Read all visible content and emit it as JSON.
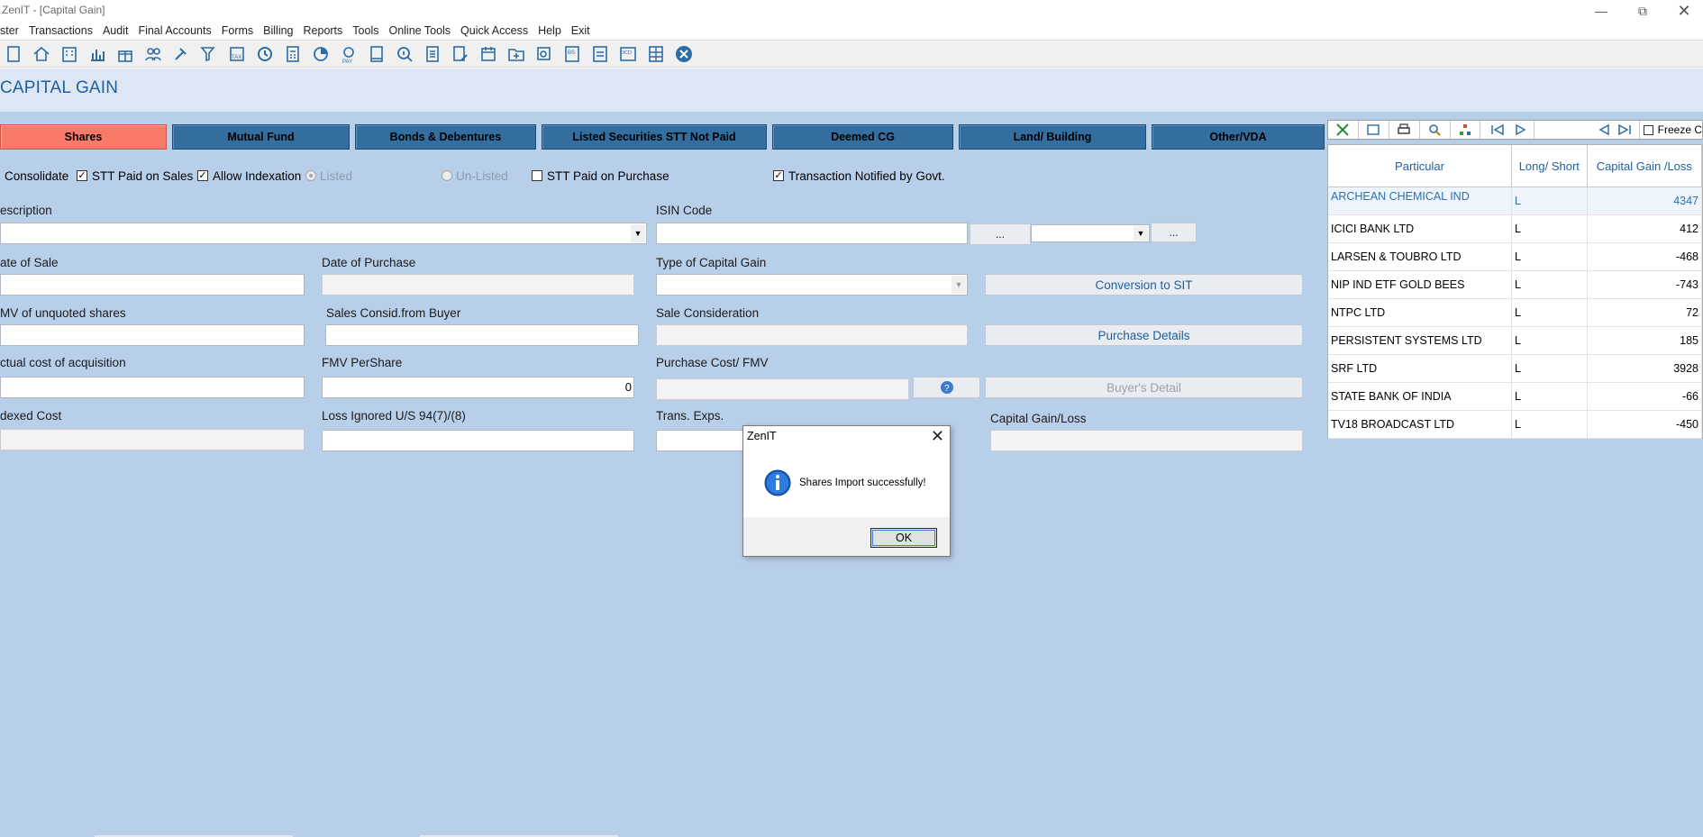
{
  "window": {
    "title": "ZenIT - [Capital Gain]",
    "controls": [
      "minimize",
      "restore",
      "close"
    ]
  },
  "menu": [
    "ster",
    "Transactions",
    "Audit",
    "Final Accounts",
    "Forms",
    "Billing",
    "Reports",
    "Tools",
    "Online Tools",
    "Quick Access",
    "Help",
    "Exit"
  ],
  "page": {
    "title": "CAPITAL GAIN"
  },
  "tabs": [
    "Shares",
    "Mutual Fund",
    "Bonds & Debentures",
    "Listed Securities STT Not Paid",
    "Deemed CG",
    "Land/ Building",
    "Other/VDA"
  ],
  "options": {
    "consolidate": "Consolidate",
    "stt_sales": "STT Paid on Sales",
    "indexation": "Allow Indexation",
    "listed": "Listed",
    "unlisted": "Un-Listed",
    "stt_purchase": "STT Paid on Purchase",
    "notified": "Transaction Notified by Govt."
  },
  "labels": {
    "description": "escription",
    "isin": "ISIN Code",
    "date_sale": "ate of Sale",
    "date_purchase": "Date of Purchase",
    "type_cg": "Type of Capital Gain",
    "fmv_unquoted": "MV of unquoted shares",
    "sales_consid_buyer": "Sales Consid.from Buyer",
    "sale_consideration": "Sale Consideration",
    "actual_cost": "ctual cost of acquisition",
    "fmv_per_share": "FMV PerShare",
    "purchase_cost_fmv": "Purchase Cost/ FMV",
    "indexed_cost": "dexed Cost",
    "loss_ignored": "Loss Ignored U/S 94(7)/(8)",
    "trans_exps": "Trans. Exps.",
    "capital_gain_loss": "Capital Gain/Loss"
  },
  "values": {
    "fmv_per_share": "0"
  },
  "buttons": {
    "isin_browse": "...",
    "dd_browse": "...",
    "conversion": "Conversion to SIT",
    "purchase_details": "Purchase Details",
    "buyers_detail": "Buyer's Detail"
  },
  "grid": {
    "freeze": "Freeze C",
    "headers": [
      "Particular",
      "Long/ Short",
      "Capital Gain /Loss"
    ],
    "rows": [
      {
        "particular": "ARCHEAN CHEMICAL IND",
        "ls": "L",
        "cg": "4347"
      },
      {
        "particular": "ICICI BANK LTD",
        "ls": "L",
        "cg": "412"
      },
      {
        "particular": "LARSEN & TOUBRO LTD",
        "ls": "L",
        "cg": "-468"
      },
      {
        "particular": "NIP IND ETF GOLD BEES",
        "ls": "L",
        "cg": "-743"
      },
      {
        "particular": "NTPC LTD",
        "ls": "L",
        "cg": "72"
      },
      {
        "particular": "PERSISTENT SYSTEMS LTD",
        "ls": "L",
        "cg": "185"
      },
      {
        "particular": "SRF LTD",
        "ls": "L",
        "cg": "3928"
      },
      {
        "particular": "STATE BANK OF INDIA",
        "ls": "L",
        "cg": "-66"
      },
      {
        "particular": "TV18 BROADCAST LTD",
        "ls": "L",
        "cg": "-450"
      }
    ]
  },
  "dialog": {
    "title": "ZenIT",
    "message": "Shares Import successfully!",
    "ok": "OK"
  },
  "colors": {
    "form_bg": "#b8cfea",
    "tab_bg": "#336e9f",
    "active_tab_bg": "#fa7a6a",
    "accent_text": "#1f5fa0"
  }
}
